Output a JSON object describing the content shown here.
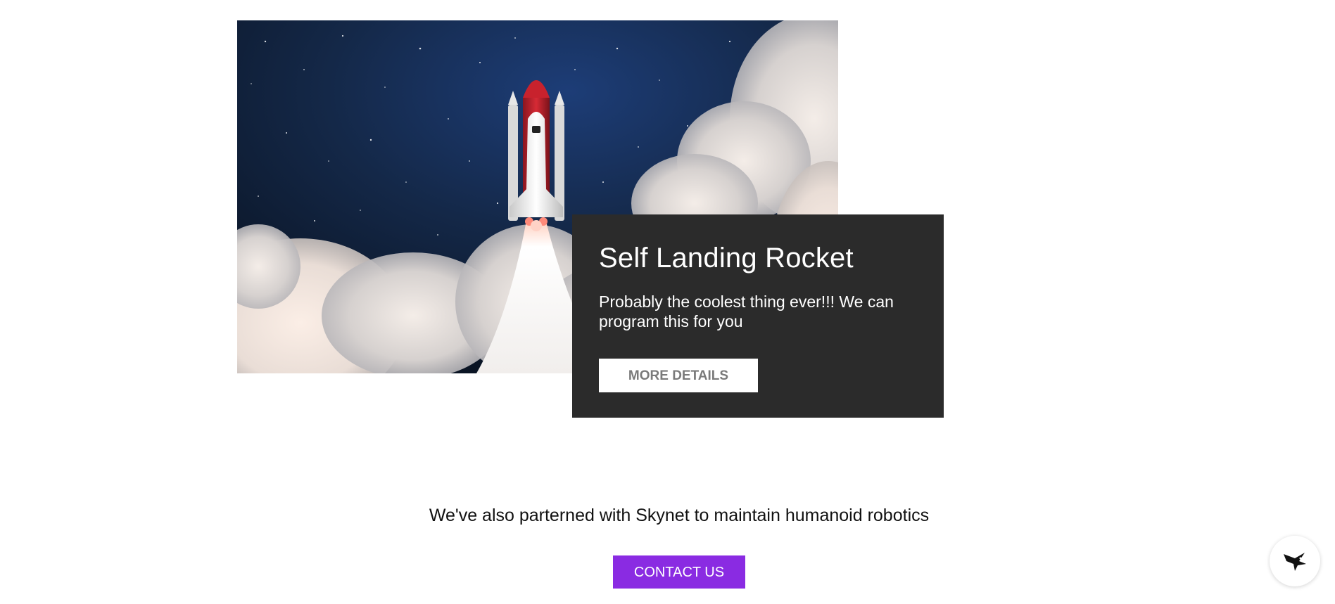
{
  "hero": {
    "image_name": "rocket-launch-image"
  },
  "card": {
    "title": "Self Landing Rocket",
    "description": "Probably the coolest thing ever!!! We can program this for you",
    "button_label": "MORE DETAILS"
  },
  "partner": {
    "text": "We've also parterned with Skynet to maintain humanoid robotics",
    "button_label": "CONTACT US"
  },
  "widget": {
    "icon": "bird-icon"
  },
  "colors": {
    "card_background": "#2b2b2b",
    "contact_button": "#8a2be2",
    "details_button_text": "#7a7a7a"
  }
}
